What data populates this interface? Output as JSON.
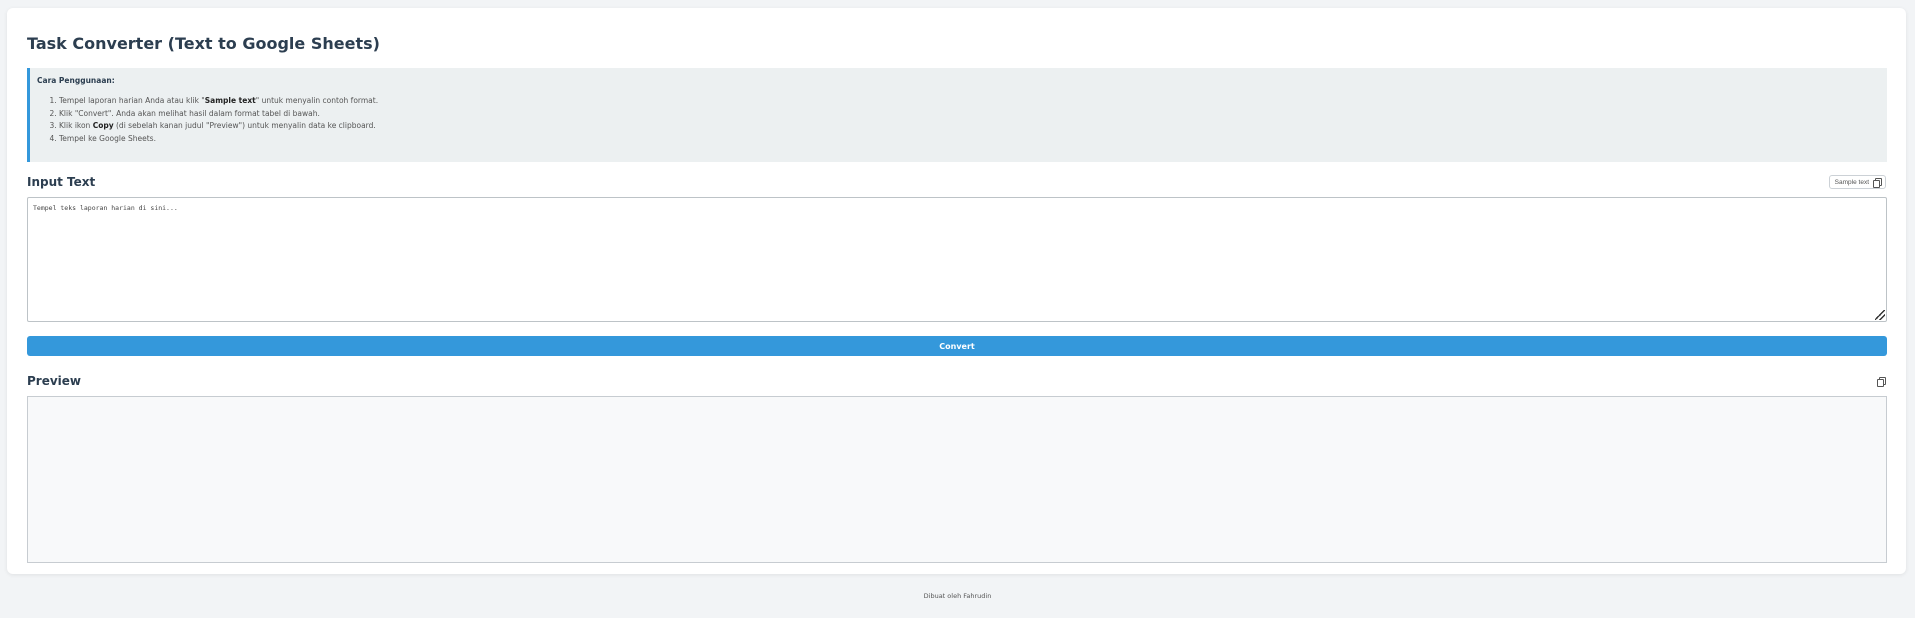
{
  "header": {
    "title": "Task Converter (Text to Google Sheets)"
  },
  "instructions": {
    "title": "Cara Penggunaan:",
    "steps": [
      {
        "before": "Tempel laporan harian Anda atau klik \"",
        "bold": "Sample text",
        "after": "\" untuk menyalin contoh format."
      },
      {
        "before": "Klik \"Convert\". Anda akan melihat hasil dalam format tabel di bawah.",
        "bold": "",
        "after": ""
      },
      {
        "before": "Klik ikon ",
        "bold": "Copy",
        "after": " (di sebelah kanan judul \"Preview\") untuk menyalin data ke clipboard."
      },
      {
        "before": "Tempel ke Google Sheets.",
        "bold": "",
        "after": ""
      }
    ]
  },
  "input": {
    "title": "Input Text",
    "sample_button_label": "Sample text",
    "placeholder": "Tempel teks laporan harian di sini...",
    "value": ""
  },
  "convert": {
    "label": "Convert"
  },
  "preview": {
    "title": "Preview"
  },
  "footer": {
    "text": "Dibuat oleh Fahrudin"
  },
  "colors": {
    "accent": "#3498db",
    "page_background": "#f2f4f6",
    "card_background": "#ffffff",
    "instructions_background": "#ecf0f1",
    "preview_background": "#f8f9fa",
    "heading": "#2c3e50"
  },
  "icons": {
    "sample_button_icon": "copy-icon",
    "preview_copy_icon": "copy-icon",
    "textarea_resize": "resize-handle-icon"
  }
}
